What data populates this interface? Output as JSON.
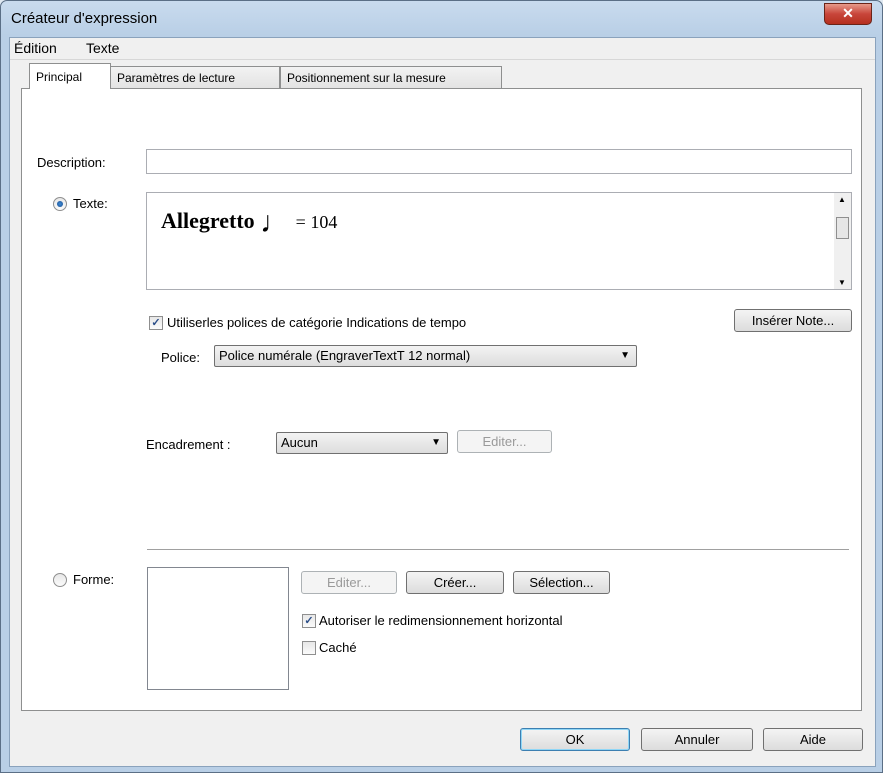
{
  "window": {
    "title": "Créateur d'expression",
    "close_glyph": "✕"
  },
  "menu": [
    "Édition",
    "Texte"
  ],
  "tabs": [
    "Principal",
    "Paramètres de lecture",
    "Positionnement sur la mesure"
  ],
  "description": {
    "label": "Description:",
    "value": ""
  },
  "texte": {
    "label": "Texte:",
    "selected": true,
    "bold_text": "Allegretto",
    "note_glyph": "♩",
    "tempo_text": "= 104",
    "insert_note_button": "Insérer Note..."
  },
  "use_fonts": {
    "label": "Utiliserles polices de catégorie Indications de tempo",
    "checked": true
  },
  "police": {
    "label": "Police:",
    "value": "Police numérale (EngraverTextT 12 normal)"
  },
  "encadrement": {
    "label": "Encadrement :",
    "value": "Aucun",
    "edit_button": "Editer..."
  },
  "forme": {
    "label": "Forme:",
    "selected": false,
    "edit_button": "Editer...",
    "create_button": "Créer...",
    "select_button": "Sélection...",
    "allow_resize": {
      "label": "Autoriser le redimensionnement horizontal",
      "checked": true
    },
    "hidden": {
      "label": "Caché",
      "checked": false
    }
  },
  "footer": {
    "ok": "OK",
    "cancel": "Annuler",
    "help": "Aide"
  }
}
